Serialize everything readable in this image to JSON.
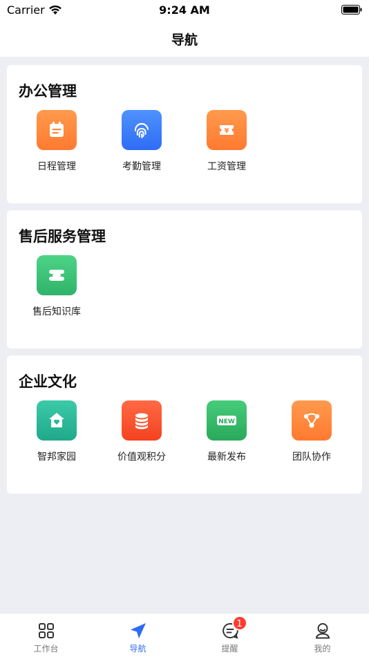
{
  "status_bar": {
    "carrier": "Carrier",
    "time": "9:24 AM"
  },
  "header": {
    "title": "导航"
  },
  "sections": [
    {
      "title": "办公管理",
      "items": [
        {
          "label": "日程管理",
          "icon": "calendar-icon",
          "color": "#ff8a3d"
        },
        {
          "label": "考勤管理",
          "icon": "fingerprint-icon",
          "color": "#3b7cf7"
        },
        {
          "label": "工资管理",
          "icon": "salary-ticket-icon",
          "color": "#ff8a3d"
        }
      ]
    },
    {
      "title": "售后服务管理",
      "items": [
        {
          "label": "售后知识库",
          "icon": "knowledge-base-icon",
          "color": "#3cc177"
        }
      ]
    },
    {
      "title": "企业文化",
      "items": [
        {
          "label": "智邦家园",
          "icon": "home-heart-icon",
          "color": "#2bb897"
        },
        {
          "label": "价值观积分",
          "icon": "coin-stack-icon",
          "color": "#f75a33"
        },
        {
          "label": "最新发布",
          "icon": "new-badge-icon",
          "color": "#38bb6c",
          "badge_text": "NEW"
        },
        {
          "label": "团队协作",
          "icon": "team-network-icon",
          "color": "#ff8a3d"
        }
      ]
    }
  ],
  "tabbar": {
    "items": [
      {
        "label": "工作台",
        "icon": "grid-icon"
      },
      {
        "label": "导航",
        "icon": "navigation-arrow-icon"
      },
      {
        "label": "提醒",
        "icon": "message-icon",
        "badge": "1"
      },
      {
        "label": "我的",
        "icon": "user-icon"
      }
    ],
    "active_color": "#2f6cf4"
  }
}
